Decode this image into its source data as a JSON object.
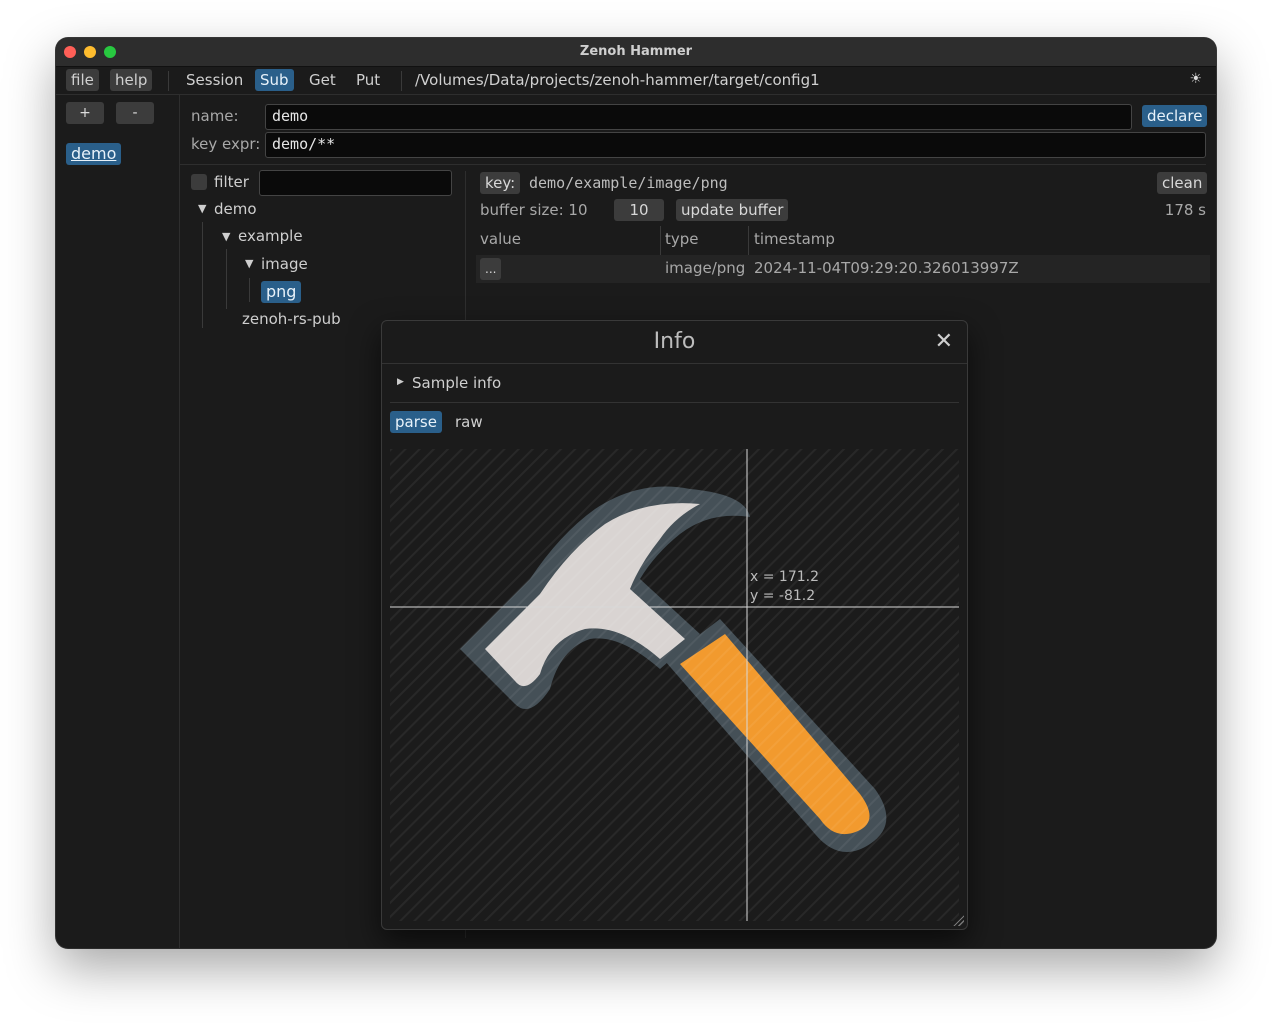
{
  "window": {
    "title": "Zenoh Hammer"
  },
  "menu": {
    "file": "file",
    "help": "help",
    "tabs": [
      "Session",
      "Sub",
      "Get",
      "Put"
    ],
    "active_tab": "Sub",
    "config_path": "/Volumes/Data/projects/zenoh-hammer/target/config1",
    "theme_icon": "☀"
  },
  "sidebar": {
    "add": "+",
    "remove": "-",
    "items": [
      "demo"
    ]
  },
  "sub_form": {
    "name_label": "name:",
    "name_value": "demo",
    "declare": "declare",
    "keyexpr_label": "key expr:",
    "keyexpr_value": "demo/**"
  },
  "tree": {
    "filter_label": "filter",
    "filter_value": "",
    "nodes": [
      {
        "label": "demo",
        "expanded": true
      },
      {
        "label": "example",
        "expanded": true
      },
      {
        "label": "image",
        "expanded": true
      },
      {
        "label": "png",
        "selected": true
      },
      {
        "label": "zenoh-rs-pub"
      }
    ]
  },
  "detail": {
    "key_label": "key:",
    "key_value": "demo/example/image/png",
    "clean": "clean",
    "buffer_label": "buffer size: 10",
    "buffer_input": "10",
    "update_buffer": "update buffer",
    "elapsed": "178 s",
    "columns": [
      "value",
      "type",
      "timestamp"
    ],
    "rows": [
      {
        "value": "...",
        "type": "image/png",
        "timestamp": "2024-11-04T09:29:20.326013997Z"
      }
    ]
  },
  "info_modal": {
    "title": "Info",
    "sample_info": "Sample info",
    "tabs": [
      "parse",
      "raw"
    ],
    "active_tab": "parse",
    "cursor_x": "x = 171.2",
    "cursor_y": "y = -81.2",
    "image_subject": "hammer-icon",
    "colors": {
      "handle": "#f29a2e",
      "head": "#d9d4d2",
      "outline": "#455057"
    }
  }
}
